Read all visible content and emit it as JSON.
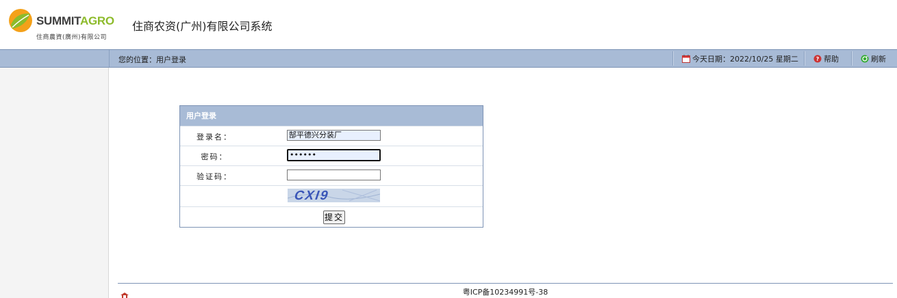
{
  "header": {
    "logo_word_1": "SUMMIT",
    "logo_word_2": "AGRO",
    "logo_sub": "住商農資(廣州)有限公司",
    "system_title": "住商农资(广州)有限公司系统"
  },
  "navbar": {
    "breadcrumb": "您的位置：用户登录",
    "date_text": "今天日期：2022/10/25 星期二",
    "help_label": "帮助",
    "refresh_label": "刷新"
  },
  "login": {
    "panel_title": "用户登录",
    "username_label": "登录名：",
    "username_value": "郜平德兴分装厂",
    "password_label": "密码：",
    "password_value": "••••••",
    "captcha_label": "验证码：",
    "captcha_input_value": "",
    "captcha_text": "CXI9",
    "submit_label": "提交"
  },
  "footer": {
    "icp": "粤ICP备10234991号-38"
  },
  "colors": {
    "navbar_bg": "#a8bbd6",
    "brand_green": "#8dbb2b",
    "brand_orange": "#f4a11a",
    "border_blue": "#7d93b5"
  },
  "icons": {
    "calendar": "calendar-icon",
    "help": "help-icon",
    "refresh": "refresh-icon"
  }
}
